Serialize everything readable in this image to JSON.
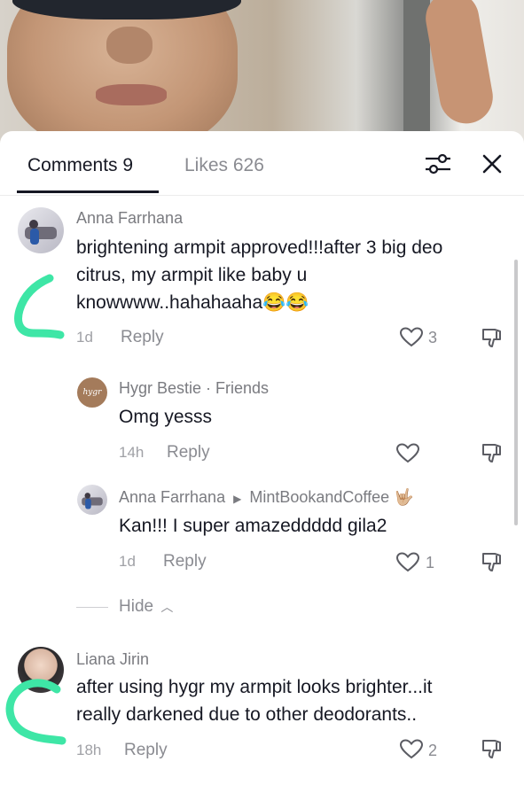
{
  "tabs": {
    "comments_label": "Comments 9",
    "likes_label": "Likes 626"
  },
  "icons": {
    "filter": "filter-sliders-icon",
    "close": "close-icon",
    "heart": "heart-outline-icon",
    "dislike": "thumbs-down-icon",
    "caret": "chevron-up-icon"
  },
  "comments": [
    {
      "author": "Anna Farrhana",
      "text_lines": [
        "brightening armpit approved!!!after 3 big deo",
        "citrus, my armpit like baby u",
        "knowwww..hahahaaha😂😂"
      ],
      "time": "1d",
      "reply_label": "Reply",
      "like_count": "3"
    },
    {
      "author": "Hygr Bestie · Friends",
      "avatar_text": "hygr",
      "text": "Omg yesss",
      "time": "14h",
      "reply_label": "Reply",
      "like_count": ""
    },
    {
      "author": "Anna Farrhana",
      "reply_to": "MintBookandCoffee",
      "reply_to_emoji": "🤟🏼",
      "text": "Kan!!! I super amazeddddd gila2",
      "time": "1d",
      "reply_label": "Reply",
      "like_count": "1"
    },
    {
      "author": "Liana Jirin",
      "text_lines": [
        "after using hygr my armpit looks brighter...it",
        "really darkened due to other deodorants.."
      ],
      "time": "18h",
      "reply_label": "Reply",
      "like_count": "2"
    }
  ],
  "hide_label": "Hide",
  "colors": {
    "text_primary": "#161823",
    "text_secondary": "#8a8b91",
    "annotation_green": "#3ee6a6"
  }
}
